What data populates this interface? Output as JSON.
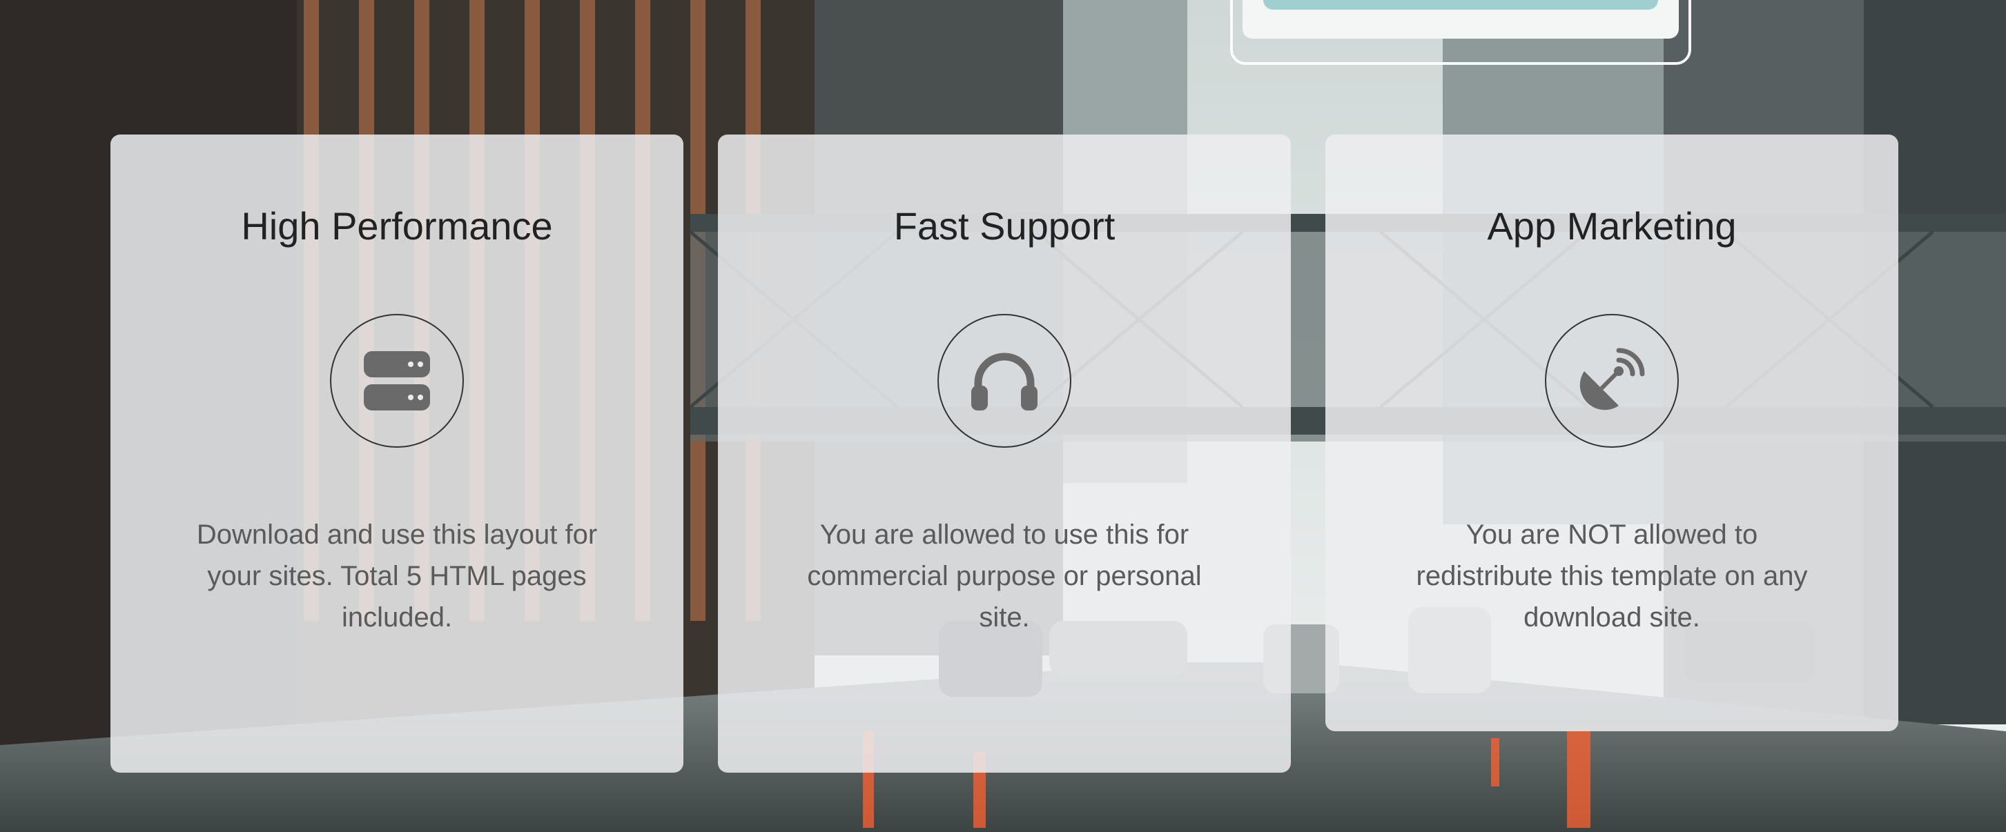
{
  "cards": [
    {
      "title": "High Performance",
      "icon": "server-icon",
      "text": "Download and use this layout for your sites. Total 5 HTML pages included."
    },
    {
      "title": "Fast Support",
      "icon": "headphones-icon",
      "text": "You are allowed to use this for commercial purpose or personal site."
    },
    {
      "title": "App Marketing",
      "icon": "satellite-dish-icon",
      "text": "You are NOT allowed to redistribute this template on any download site."
    }
  ],
  "colors": {
    "card_bg": "#eceef0",
    "icon": "#6a6a6a",
    "title": "#222222",
    "body_text": "#5a5a5a",
    "accent": "#9fd0cf"
  }
}
